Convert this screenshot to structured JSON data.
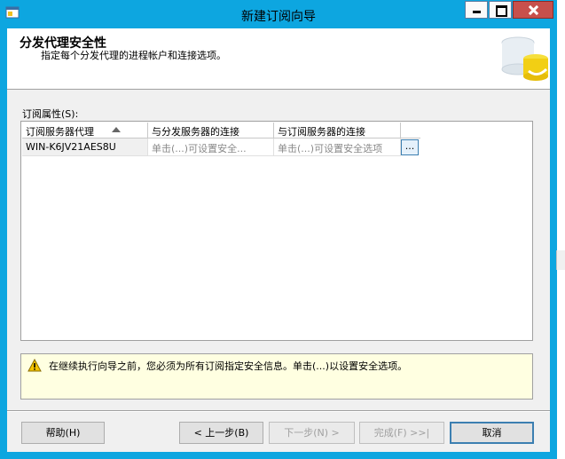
{
  "window": {
    "title": "新建订阅向导"
  },
  "header": {
    "title": "分发代理安全性",
    "subtitle": "指定每个分发代理的进程帐户和连接选项。"
  },
  "grid": {
    "label": "订阅属性(S):",
    "columns": [
      "订阅服务器代理",
      "与分发服务器的连接",
      "与订阅服务器的连接"
    ],
    "rows": [
      {
        "agent": "WIN-K6JV21AES8U",
        "distributor_conn": "单击(...)可设置安全...",
        "subscriber_conn": "单击(...)可设置安全选项",
        "button": "..."
      }
    ]
  },
  "warning": {
    "text": "在继续执行向导之前，您必须为所有订阅指定安全信息。单击(...)以设置安全选项。"
  },
  "buttons": {
    "help": "帮助(H)",
    "back": "< 上一步(B)",
    "next": "下一步(N) >",
    "finish": "完成(F) >>|",
    "cancel": "取消"
  },
  "colors": {
    "frame": "#0da6e0",
    "close_button": "#c7504c",
    "warning_bg": "#ffffe1"
  }
}
